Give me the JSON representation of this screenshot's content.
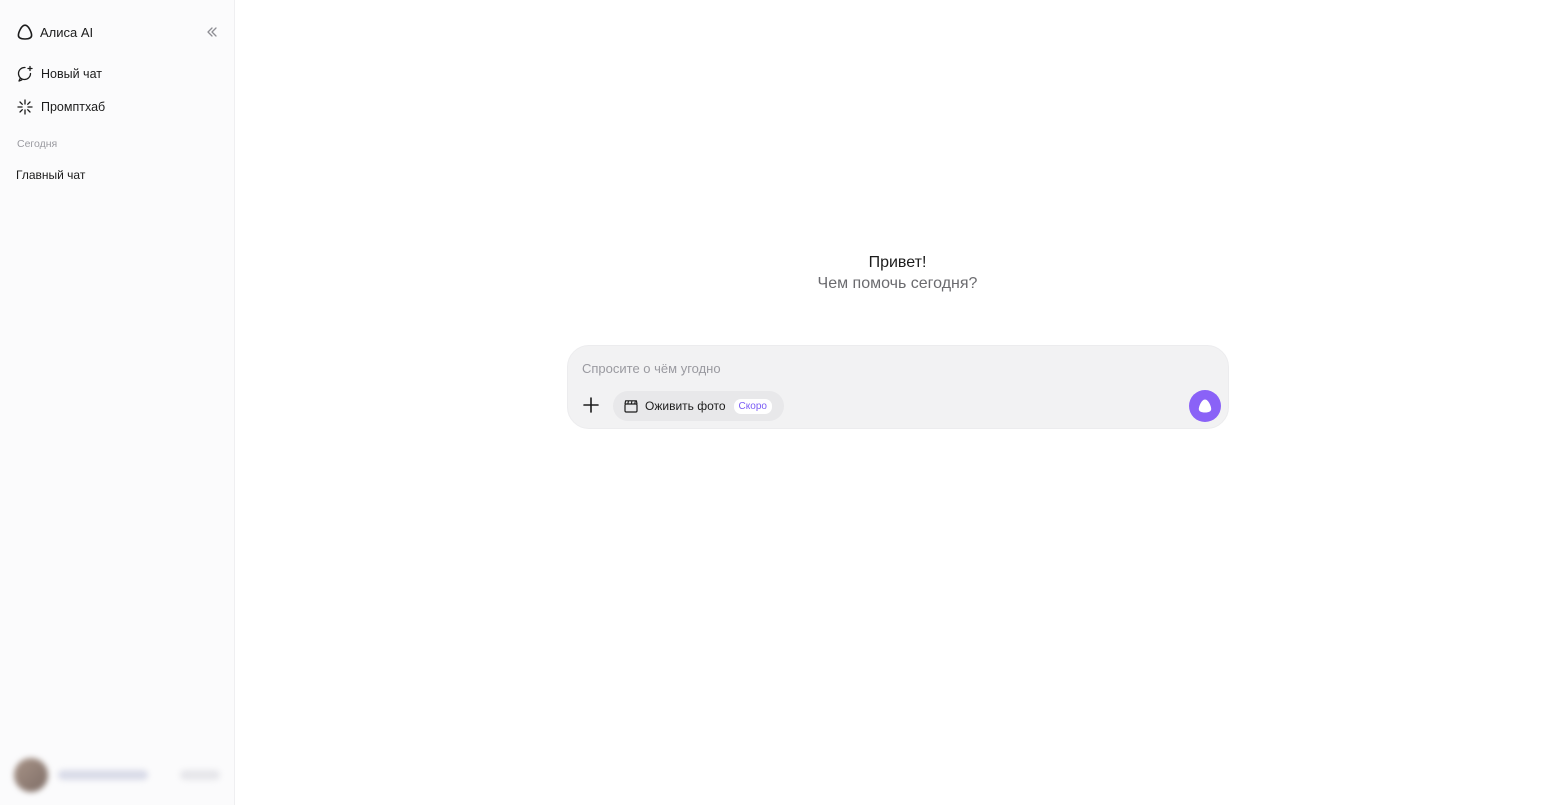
{
  "sidebar": {
    "brand": "Алиса AI",
    "items": [
      {
        "label": "Новый чат",
        "icon": "new-chat-icon"
      },
      {
        "label": "Промптхаб",
        "icon": "sparkle-icon"
      }
    ],
    "section_label": "Сегодня",
    "chats": [
      "Главный чат"
    ]
  },
  "main": {
    "greeting_title": "Привет!",
    "greeting_subtitle": "Чем помочь сегодня?",
    "composer": {
      "placeholder": "Спросите о чём угодно",
      "chip_label": "Оживить фото",
      "chip_badge": "Скоро"
    }
  },
  "colors": {
    "accent": "#8a62f7",
    "badge_text": "#7a5cf5",
    "composer_bg": "#f2f2f3",
    "sidebar_bg": "#fbfbfc"
  }
}
